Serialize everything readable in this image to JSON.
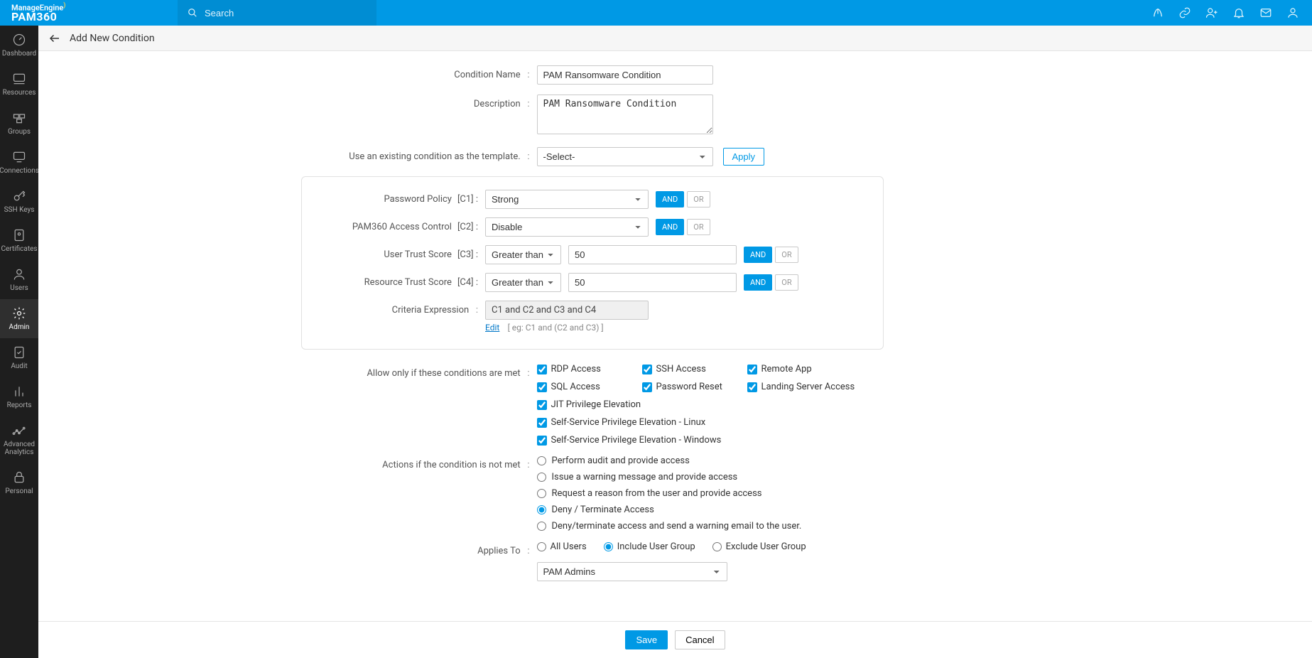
{
  "brand": {
    "top": "ManageEngine",
    "bottom": "PAM360"
  },
  "search": {
    "placeholder": "Search"
  },
  "sidebar": {
    "items": [
      {
        "label": "Dashboard"
      },
      {
        "label": "Resources"
      },
      {
        "label": "Groups"
      },
      {
        "label": "Connections"
      },
      {
        "label": "SSH Keys"
      },
      {
        "label": "Certificates"
      },
      {
        "label": "Users"
      },
      {
        "label": "Admin"
      },
      {
        "label": "Audit"
      },
      {
        "label": "Reports"
      },
      {
        "label": "Advanced Analytics"
      },
      {
        "label": "Personal"
      }
    ]
  },
  "page": {
    "title": "Add New Condition"
  },
  "form": {
    "conditionNameLabel": "Condition Name",
    "conditionName": "PAM Ransomware Condition",
    "descriptionLabel": "Description",
    "description": "PAM Ransomware Condition",
    "templateLabel": "Use an existing condition as the template.",
    "templateSelected": "-Select-",
    "applyLabel": "Apply"
  },
  "criteria": {
    "c1": {
      "label": "Password Policy",
      "code": "[C1] :",
      "value": "Strong",
      "logic": "AND"
    },
    "c2": {
      "label": "PAM360 Access Control",
      "code": "[C2] :",
      "value": "Disable",
      "logic": "AND"
    },
    "c3": {
      "label": "User Trust Score",
      "code": "[C3] :",
      "op": "Greater than",
      "num": "50",
      "logic": "AND"
    },
    "c4": {
      "label": "Resource Trust Score",
      "code": "[C4] :",
      "op": "Greater than",
      "num": "50",
      "logic": "AND"
    },
    "expressionLabel": "Criteria Expression",
    "expression": "C1 and C2 and C3 and C4",
    "editLabel": "Edit",
    "hint": "[ eg: C1 and (C2 and C3) ]",
    "and": "AND",
    "or": "OR"
  },
  "allow": {
    "label": "Allow only if these conditions are met",
    "rdp": "RDP Access",
    "ssh": "SSH Access",
    "remote": "Remote App",
    "sql": "SQL Access",
    "pwd": "Password Reset",
    "landing": "Landing Server Access",
    "jit": "JIT Privilege Elevation",
    "sslinux": "Self-Service Privilege Elevation - Linux",
    "sswin": "Self-Service Privilege Elevation - Windows"
  },
  "actions": {
    "label": "Actions if the condition is not met",
    "a1": "Perform audit and provide access",
    "a2": "Issue a warning message and provide access",
    "a3": "Request a reason from the user and provide access",
    "a4": "Deny / Terminate Access",
    "a5": "Deny/terminate access and send a warning email to the user."
  },
  "applies": {
    "label": "Applies To",
    "all": "All Users",
    "include": "Include User Group",
    "exclude": "Exclude User Group",
    "groupSelected": "PAM Admins"
  },
  "footer": {
    "save": "Save",
    "cancel": "Cancel"
  }
}
